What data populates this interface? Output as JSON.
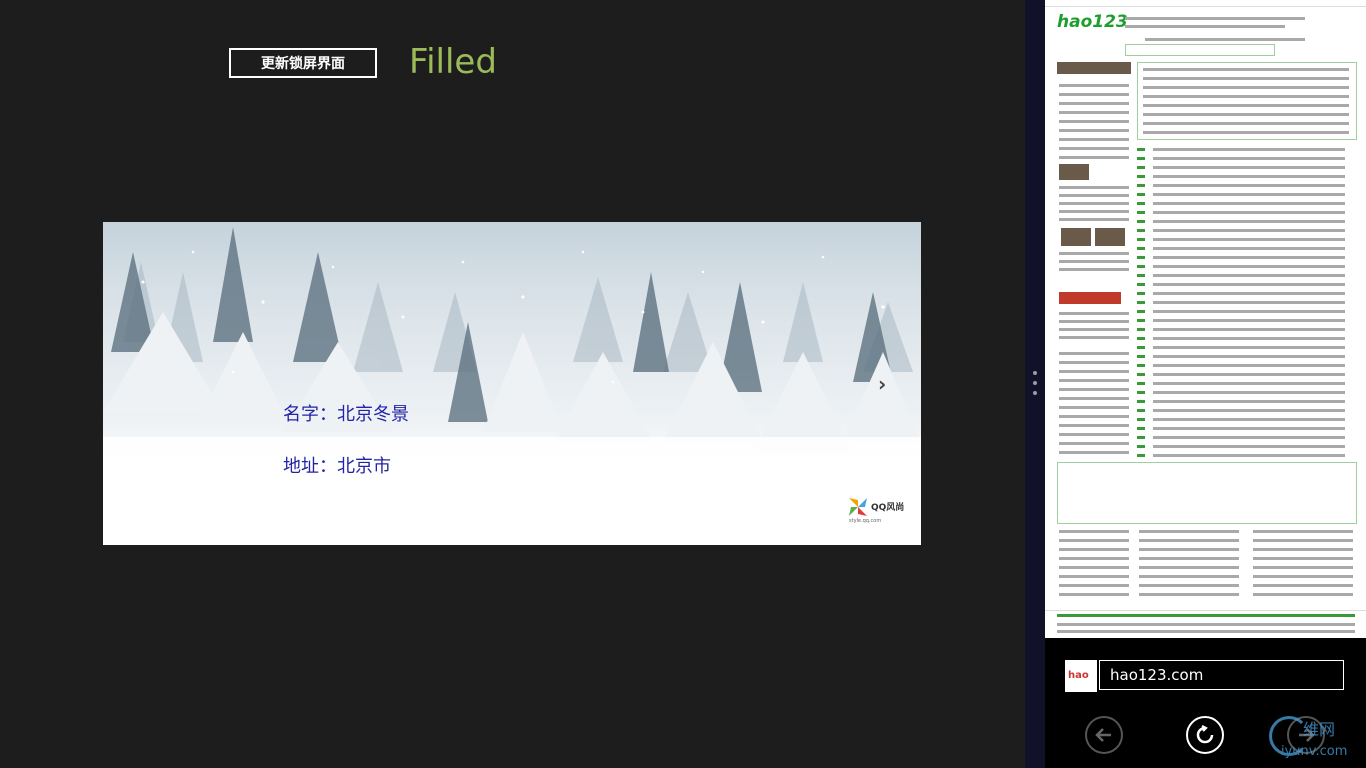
{
  "left_app": {
    "update_button_label": "更新锁屏界面",
    "state_label": "Filled",
    "scene": {
      "name_text": "名字：北京冬景",
      "address_text": "地址：北京市",
      "next_arrow": "›",
      "qq_logo_text": "QQ风尚",
      "qq_logo_subtext": "style.qq.com"
    }
  },
  "right_app": {
    "site_icon_text": "hao",
    "url": "hao123.com",
    "page_logo": "hao123",
    "watermark_top": "维网",
    "watermark_bottom": "iyunv.com"
  },
  "colors": {
    "background": "#1d1d1d",
    "accent_green": "#9bbb59",
    "label_blue": "#2323a8",
    "splitter": "#11112a"
  }
}
